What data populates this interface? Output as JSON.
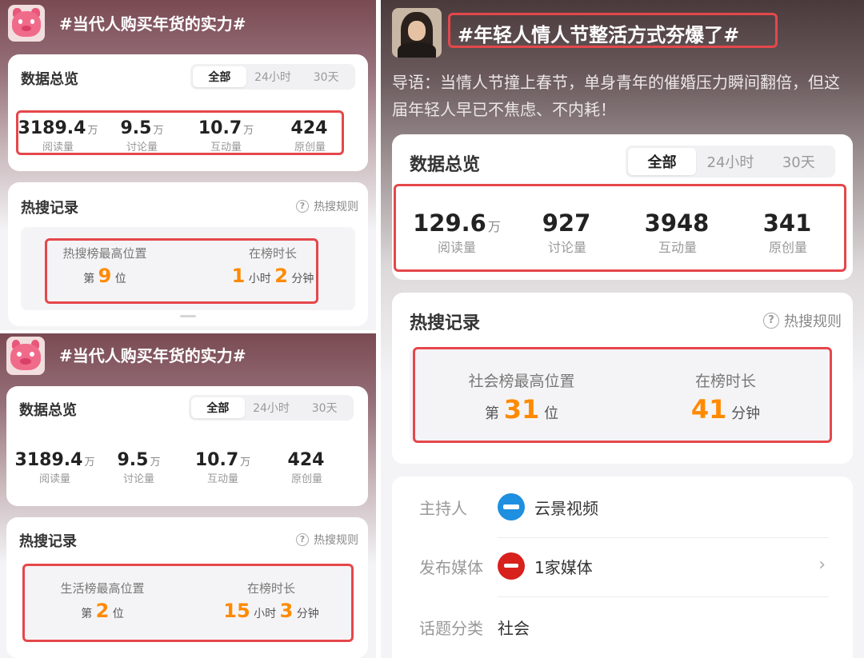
{
  "panels": [
    {
      "topic_title": "#当代人购买年货的实力#",
      "overview": {
        "title": "数据总览",
        "tabs": [
          "全部",
          "24小时",
          "30天"
        ],
        "stats": [
          {
            "value": "3189.4",
            "unit": "万",
            "label": "阅读量"
          },
          {
            "value": "9.5",
            "unit": "万",
            "label": "讨论量"
          },
          {
            "value": "10.7",
            "unit": "万",
            "label": "互动量"
          },
          {
            "value": "424",
            "unit": "",
            "label": "原创量"
          }
        ]
      },
      "hot_search": {
        "title": "热搜记录",
        "rules": "热搜规则",
        "rank_label": "热搜榜最高位置",
        "rank_prefix": "第",
        "rank": "9",
        "rank_suffix": "位",
        "duration_label": "在榜时长",
        "hours": "1",
        "hours_unit": "小时",
        "minutes": "2",
        "minutes_unit": "分钟"
      }
    },
    {
      "topic_title": "#当代人购买年货的实力#",
      "overview": {
        "title": "数据总览",
        "tabs": [
          "全部",
          "24小时",
          "30天"
        ],
        "stats": [
          {
            "value": "3189.4",
            "unit": "万",
            "label": "阅读量"
          },
          {
            "value": "9.5",
            "unit": "万",
            "label": "讨论量"
          },
          {
            "value": "10.7",
            "unit": "万",
            "label": "互动量"
          },
          {
            "value": "424",
            "unit": "",
            "label": "原创量"
          }
        ]
      },
      "hot_search": {
        "title": "热搜记录",
        "rules": "热搜规则",
        "rank_label": "生活榜最高位置",
        "rank_prefix": "第",
        "rank": "2",
        "rank_suffix": "位",
        "duration_label": "在榜时长",
        "hours": "15",
        "hours_unit": "小时",
        "minutes": "3",
        "minutes_unit": "分钟"
      }
    },
    {
      "topic_title": "#年轻人情人节整活方式夯爆了#",
      "intro": "导语：当情人节撞上春节，单身青年的催婚压力瞬间翻倍，但这届年轻人早已不焦虑、不内耗！",
      "overview": {
        "title": "数据总览",
        "tabs": [
          "全部",
          "24小时",
          "30天"
        ],
        "stats": [
          {
            "value": "129.6",
            "unit": "万",
            "label": "阅读量"
          },
          {
            "value": "927",
            "unit": "",
            "label": "讨论量"
          },
          {
            "value": "3948",
            "unit": "",
            "label": "互动量"
          },
          {
            "value": "341",
            "unit": "",
            "label": "原创量"
          }
        ]
      },
      "hot_search": {
        "title": "热搜记录",
        "rules": "热搜规则",
        "rank_label": "社会榜最高位置",
        "rank_prefix": "第",
        "rank": "31",
        "rank_suffix": "位",
        "duration_label": "在榜时长",
        "minutes": "41",
        "minutes_unit": "分钟"
      },
      "info": {
        "host_label": "主持人",
        "host_value": "云景视频",
        "media_label": "发布媒体",
        "media_value": "1家媒体",
        "category_label": "话题分类",
        "category_value": "社会"
      }
    }
  ],
  "colors": {
    "accent_orange": "#ff8a00",
    "highlight_red": "#e5474b"
  },
  "icons": [
    "pig-avatar-icon",
    "person-avatar-icon",
    "question-icon",
    "chevron-right-icon",
    "host-logo-icon",
    "media-logo-icon"
  ]
}
